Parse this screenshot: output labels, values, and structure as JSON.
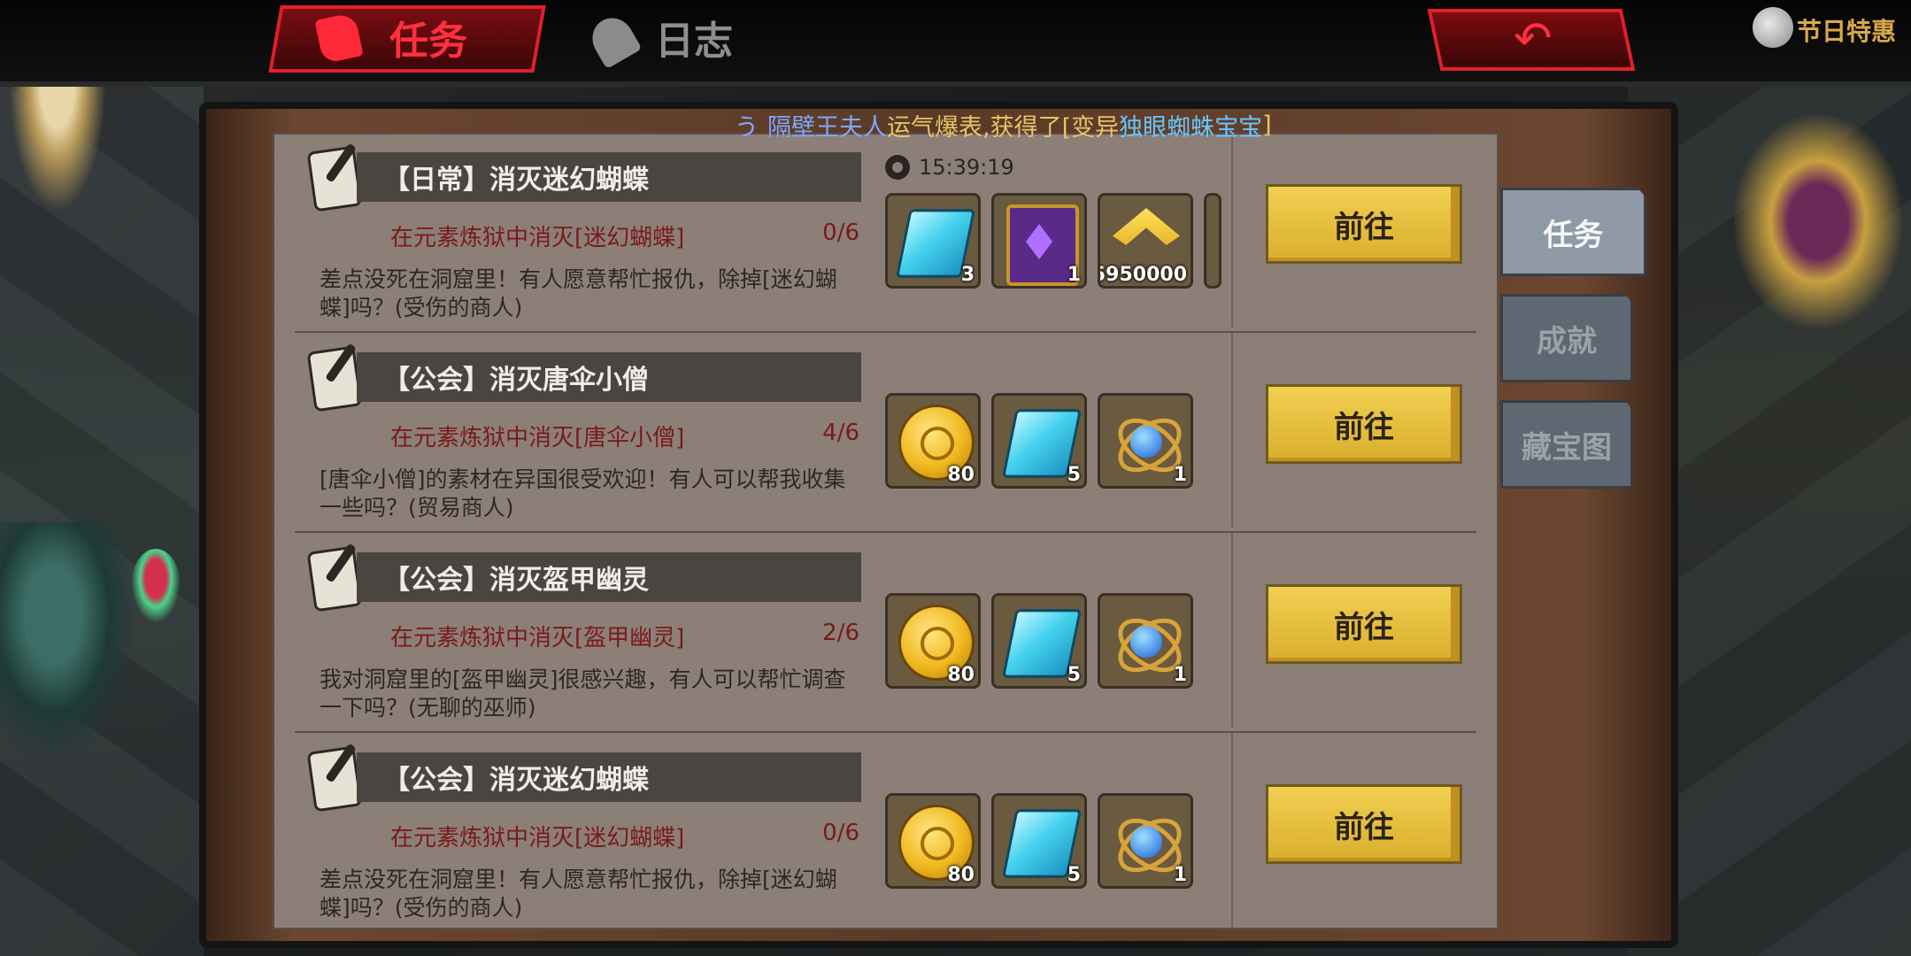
{
  "header": {
    "tabs": [
      {
        "label": "任务",
        "active": true
      },
      {
        "label": "日志",
        "active": false
      }
    ],
    "festival_label": "节日特惠"
  },
  "ticker": {
    "prefix": "う",
    "name": "隔壁王夫人",
    "text": " 运气爆表,获得了[变异 ",
    "item": "独眼蜘蛛宝宝",
    "suffix": " ]"
  },
  "timer": "15:39:19",
  "quests": [
    {
      "title": "【日常】消灭迷幻蝴蝶",
      "objective": "在元素炼狱中消灭[迷幻蝴蝶]",
      "progress": "0/6",
      "description": "差点没死在洞窟里！有人愿意帮忙报仇，除掉[迷幻蝴蝶]吗？(受伤的商人)",
      "rewards": [
        {
          "icon": "crystal-icon",
          "qty": "3"
        },
        {
          "icon": "spellbook-icon",
          "qty": "1"
        },
        {
          "icon": "exp-icon",
          "qty": "5950000"
        }
      ],
      "button": "前往"
    },
    {
      "title": "【公会】消灭唐伞小僧",
      "objective": "在元素炼狱中消灭[唐伞小僧]",
      "progress": "4/6",
      "description": "[唐伞小僧]的素材在异国很受欢迎！有人可以帮我收集一些吗？(贸易商人)",
      "rewards": [
        {
          "icon": "gold-coin-icon",
          "qty": "80"
        },
        {
          "icon": "crystal-icon",
          "qty": "5"
        },
        {
          "icon": "orb-icon",
          "qty": "1"
        }
      ],
      "button": "前往"
    },
    {
      "title": "【公会】消灭盔甲幽灵",
      "objective": "在元素炼狱中消灭[盔甲幽灵]",
      "progress": "2/6",
      "description": "我对洞窟里的[盔甲幽灵]很感兴趣，有人可以帮忙调查一下吗？(无聊的巫师)",
      "rewards": [
        {
          "icon": "gold-coin-icon",
          "qty": "80"
        },
        {
          "icon": "crystal-icon",
          "qty": "5"
        },
        {
          "icon": "orb-icon",
          "qty": "1"
        }
      ],
      "button": "前往"
    },
    {
      "title": "【公会】消灭迷幻蝴蝶",
      "objective": "在元素炼狱中消灭[迷幻蝴蝶]",
      "progress": "0/6",
      "description": "差点没死在洞窟里！有人愿意帮忙报仇，除掉[迷幻蝴蝶]吗？(受伤的商人)",
      "rewards": [
        {
          "icon": "gold-coin-icon",
          "qty": "80"
        },
        {
          "icon": "crystal-icon",
          "qty": "5"
        },
        {
          "icon": "orb-icon",
          "qty": "1"
        }
      ],
      "button": "前往"
    }
  ],
  "side_tabs": [
    {
      "label": "任务",
      "active": true
    },
    {
      "label": "成就",
      "active": false
    },
    {
      "label": "藏宝图",
      "active": false
    }
  ]
}
